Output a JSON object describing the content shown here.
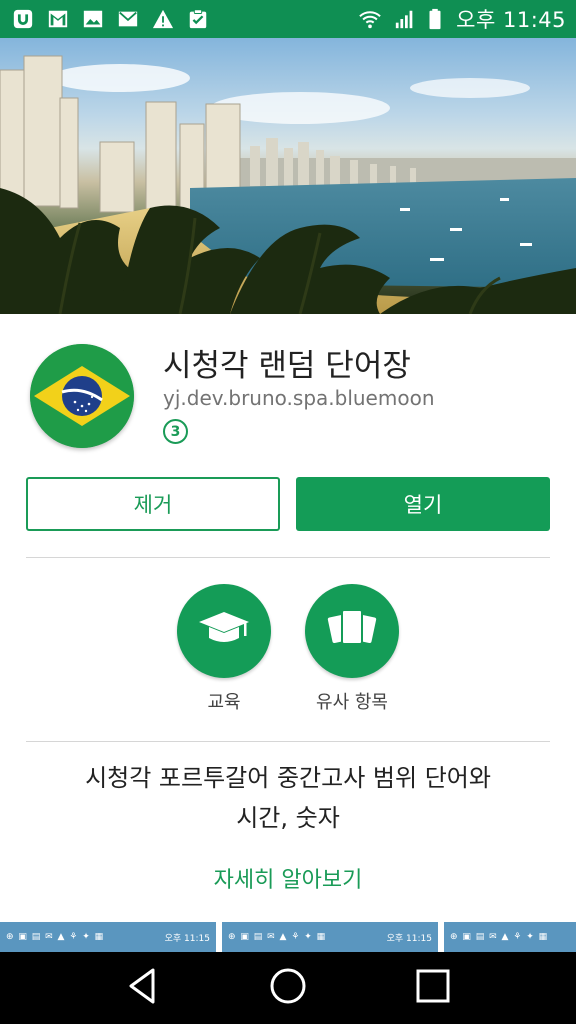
{
  "status_bar": {
    "notification_icons": [
      "uplus-icon",
      "gmail-icon",
      "image-icon",
      "mail-icon",
      "warning-icon",
      "clipboard-check-icon"
    ],
    "system_icons": [
      "wifi-icon",
      "signal-icon",
      "battery-icon"
    ],
    "time": "오후 11:45",
    "background": "#0f8f53"
  },
  "app": {
    "title": "시청각 랜덤 단어장",
    "package": "yj.dev.bruno.spa.bluemoon",
    "rating_badge": "3",
    "icon": "brazil-flag-icon"
  },
  "actions": {
    "uninstall_label": "제거",
    "open_label": "열기",
    "accent": "#149c57"
  },
  "chips": [
    {
      "label": "교육",
      "icon": "graduation-cap-icon"
    },
    {
      "label": "유사 항목",
      "icon": "similar-cards-icon"
    }
  ],
  "description": {
    "line1": "시청각 포르투갈어 중간고사 범위 단어와",
    "line2": "시간, 숫자"
  },
  "more_link": "자세히 알아보기",
  "screenshots": [
    {
      "time": "오후 11:15"
    },
    {
      "time": "오후 11:15"
    },
    {
      "time": ""
    }
  ],
  "nav": [
    "back-icon",
    "home-icon",
    "recents-icon"
  ]
}
